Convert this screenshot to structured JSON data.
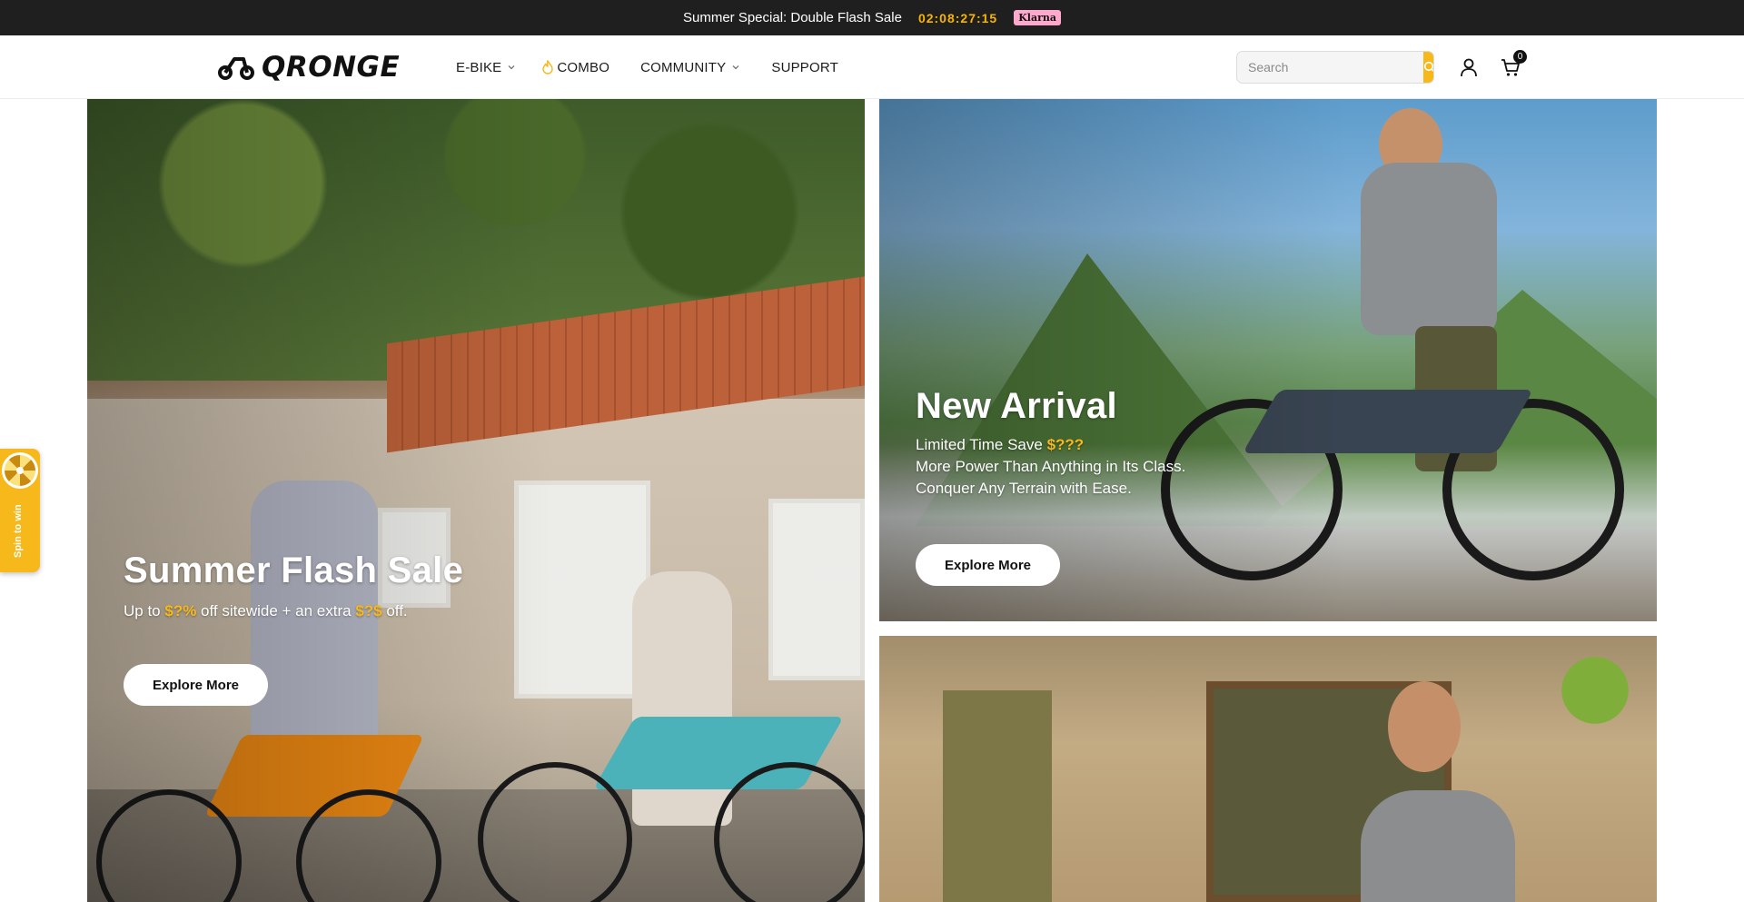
{
  "announcement": {
    "text": "Summer Special: Double Flash Sale",
    "countdown": "02:08:27:15",
    "badge": "Klarna"
  },
  "header": {
    "logo_text": "QRONGE",
    "nav": [
      {
        "label": "E-BIKE",
        "has_dropdown": true
      },
      {
        "label": "COMBO",
        "has_dropdown": false,
        "icon": "flame-icon"
      },
      {
        "label": "COMMUNITY",
        "has_dropdown": true
      },
      {
        "label": "SUPPORT",
        "has_dropdown": false
      }
    ],
    "search": {
      "placeholder": "Search"
    },
    "cart_count": "0"
  },
  "hero_left": {
    "title": "Summer Flash Sale",
    "sub_prefix": "Up to ",
    "sub_hl1": "$?%",
    "sub_mid": " off sitewide + an extra ",
    "sub_hl2": "$?$",
    "sub_suffix": " off.",
    "button": "Explore More"
  },
  "hero_right_top": {
    "title": "New Arrival",
    "line1_prefix": "Limited Time Save ",
    "line1_hl": "$???",
    "line2": "More Power Than Anything in Its Class.",
    "line3": "Conquer Any Terrain with Ease.",
    "button": "Explore More"
  },
  "spin": {
    "label": "Spin to win"
  },
  "colors": {
    "accent": "#f6b81a",
    "topbar_bg": "#1f1f1f",
    "klarna": "#ffa8cd"
  }
}
